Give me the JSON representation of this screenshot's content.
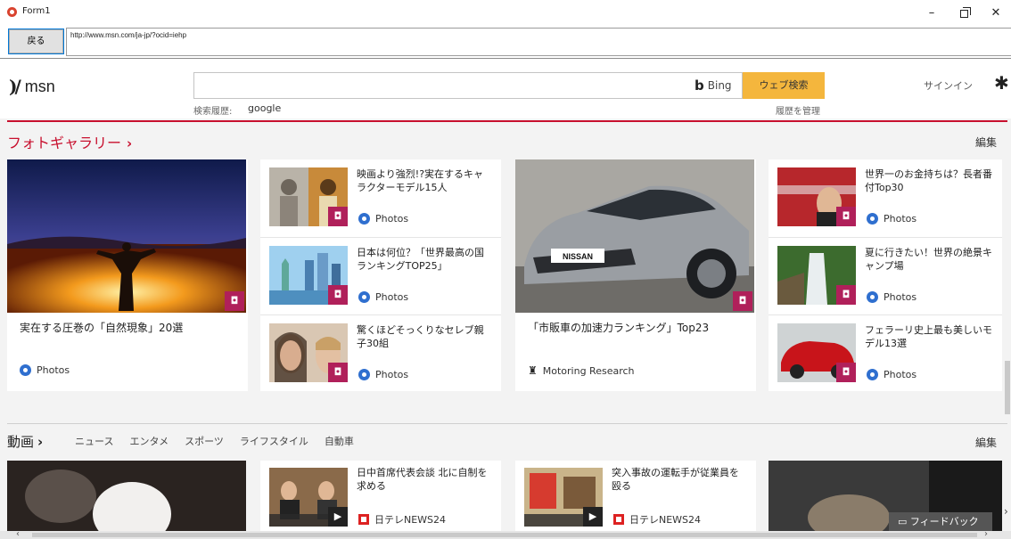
{
  "window": {
    "title": "Form1",
    "minimize": "–",
    "close": "✕"
  },
  "toolbar": {
    "back_label": "戻る",
    "url": "http://www.msn.com/ja-jp/?ocid=iehp"
  },
  "msn": {
    "logo_text": "msn",
    "search_placeholder": "",
    "bing_label": "Bing",
    "search_button": "ウェブ検索",
    "history_label": "検索履歴:",
    "history_item": "google",
    "history_manage": "履歴を管理",
    "signin": "サインイン"
  },
  "gallery": {
    "title": "フォトギャラリー",
    "chevron": "›",
    "edit": "編集",
    "big_left": {
      "title": "実在する圧巻の「自然現象」20選",
      "source": "Photos"
    },
    "col2": [
      {
        "title": "映画より強烈!?実在するキャラクターモデル15人",
        "source": "Photos"
      },
      {
        "title": "日本は何位？「世界最高の国ランキングTOP25」",
        "source": "Photos"
      },
      {
        "title": "驚くほどそっくりなセレブ親子30組",
        "source": "Photos"
      }
    ],
    "big_center": {
      "title": "「市販車の加速力ランキング」Top23",
      "source": "Motoring Research",
      "badge": "NISSAN"
    },
    "col4": [
      {
        "title": "世界一のお金持ちは？長者番付Top30",
        "source": "Photos"
      },
      {
        "title": "夏に行きたい！世界の絶景キャンプ場",
        "source": "Photos"
      },
      {
        "title": "フェラーリ史上最も美しいモデル13選",
        "source": "Photos"
      }
    ]
  },
  "video": {
    "title": "動画",
    "chevron": "›",
    "edit": "編集",
    "tabs": [
      "ニュース",
      "エンタメ",
      "スポーツ",
      "ライフスタイル",
      "自動車"
    ],
    "items": [
      {
        "title": "日中首席代表会談 北に自制を求める",
        "source": "日テレNEWS24"
      },
      {
        "title": "突入事故の運転手が従業員を殴る",
        "source": "日テレNEWS24"
      }
    ]
  },
  "feedback": "フィードバック"
}
